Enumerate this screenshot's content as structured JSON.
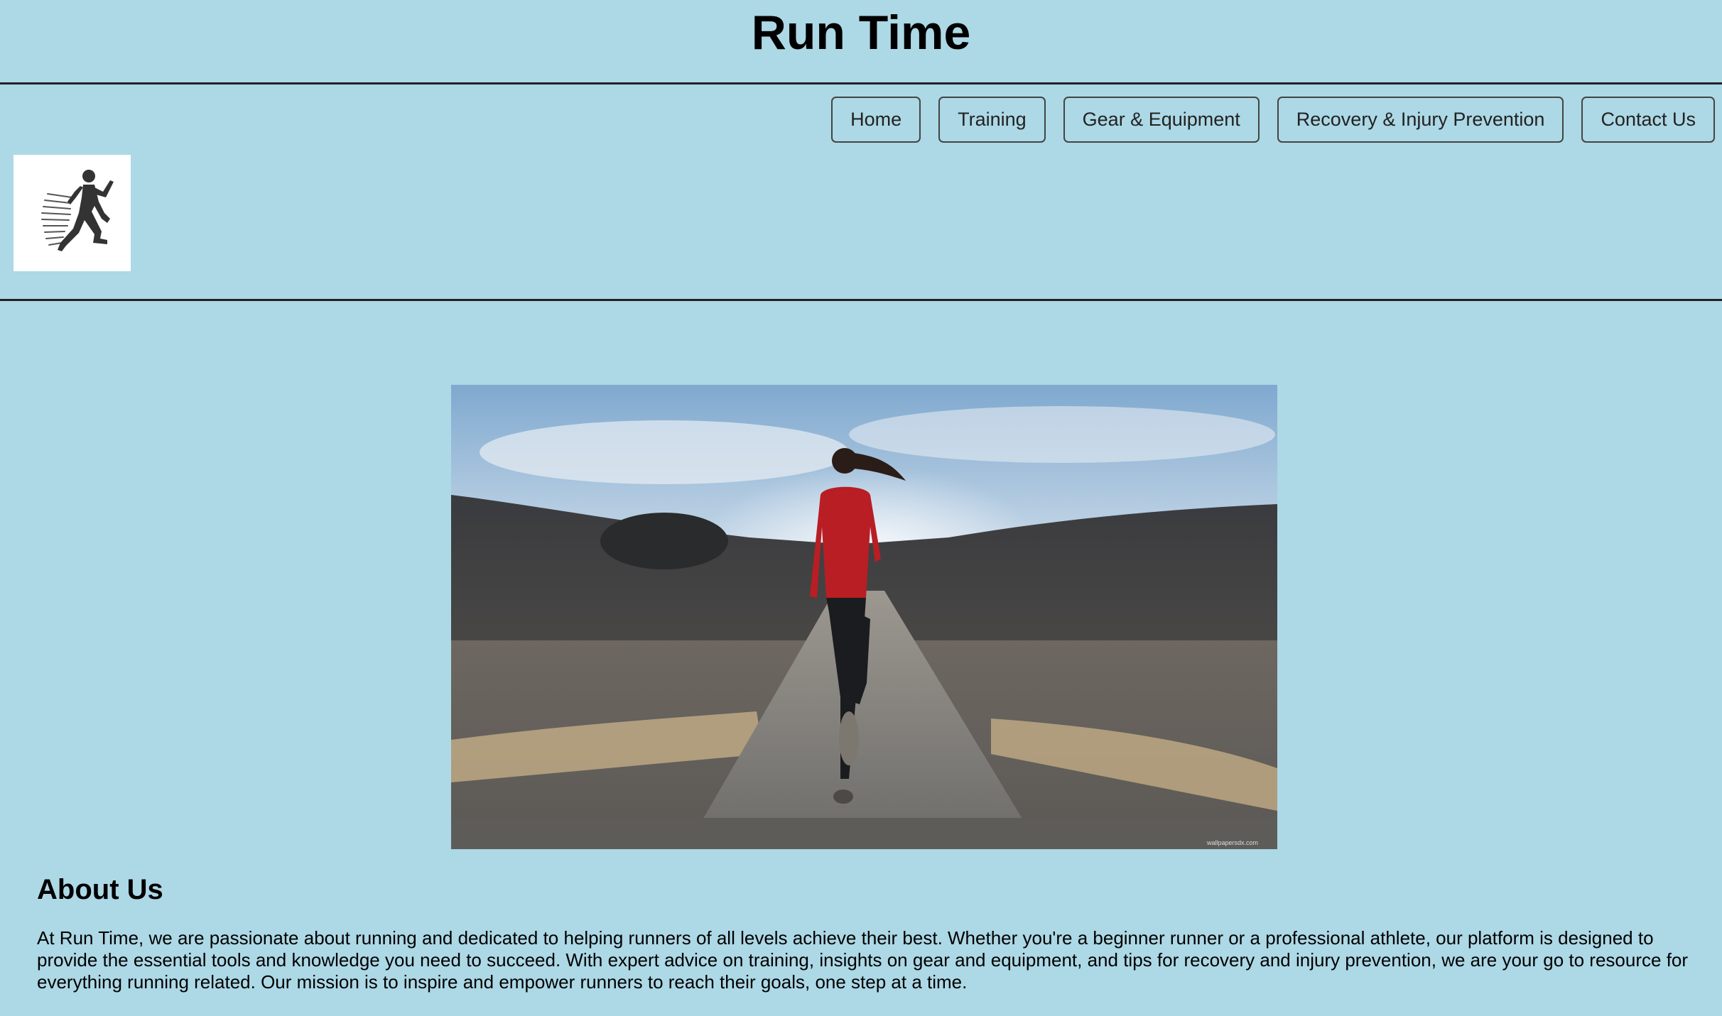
{
  "header": {
    "title": "Run Time"
  },
  "nav": {
    "items": [
      {
        "label": "Home"
      },
      {
        "label": "Training"
      },
      {
        "label": "Gear & Equipment"
      },
      {
        "label": "Recovery & Injury Prevention"
      },
      {
        "label": "Contact Us"
      }
    ]
  },
  "logo": {
    "icon": "running-person-icon"
  },
  "hero": {
    "image": "woman-running-on-road-photo",
    "watermark": "wallpapersdx.com"
  },
  "about": {
    "heading": "About Us",
    "body": "At Run Time, we are passionate about running and dedicated to helping runners of all levels achieve their best. Whether you're a beginner runner or a professional athlete, our platform is designed to provide the essential tools and knowledge you need to succeed. With expert advice on training, insights on gear and equipment, and tips for recovery and injury prevention, we are your go to resource for everything running related. Our mission is to inspire and empower runners to reach their goals, one step at a time."
  },
  "colors": {
    "background": "#add8e6",
    "rule": "#222222",
    "text": "#000000"
  }
}
